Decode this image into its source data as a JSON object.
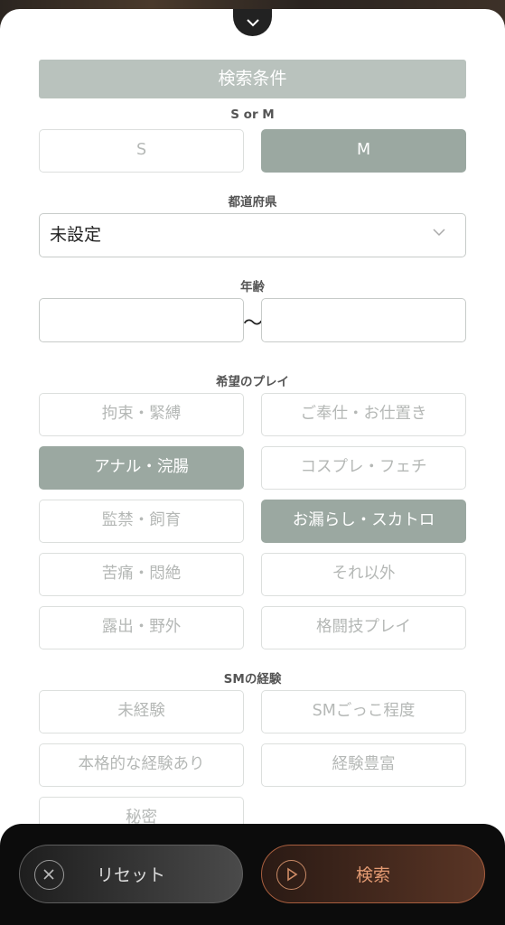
{
  "header": {
    "collapse_icon": "chevron-down-icon"
  },
  "title": "検索条件",
  "s_or_m": {
    "label": "S or M",
    "options": [
      {
        "label": "S",
        "selected": false
      },
      {
        "label": "M",
        "selected": true
      }
    ]
  },
  "prefecture": {
    "label": "都道府県",
    "value": "未設定"
  },
  "age": {
    "label": "年齢",
    "separator": "〜",
    "min": "",
    "max": ""
  },
  "play": {
    "label": "希望のプレイ",
    "options": [
      {
        "label": "拘束・緊縛",
        "selected": false
      },
      {
        "label": "ご奉仕・お仕置き",
        "selected": false
      },
      {
        "label": "アナル・浣腸",
        "selected": true
      },
      {
        "label": "コスプレ・フェチ",
        "selected": false
      },
      {
        "label": "監禁・飼育",
        "selected": false
      },
      {
        "label": "お漏らし・スカトロ",
        "selected": true
      },
      {
        "label": "苦痛・悶絶",
        "selected": false
      },
      {
        "label": "それ以外",
        "selected": false
      },
      {
        "label": "露出・野外",
        "selected": false
      },
      {
        "label": "格闘技プレイ",
        "selected": false
      }
    ]
  },
  "experience": {
    "label": "SMの経験",
    "options": [
      {
        "label": "未経験",
        "selected": false
      },
      {
        "label": "SMごっこ程度",
        "selected": false
      },
      {
        "label": "本格的な経験あり",
        "selected": false
      },
      {
        "label": "経験豊富",
        "selected": false
      },
      {
        "label": "秘密",
        "selected": false
      }
    ]
  },
  "footer": {
    "reset_label": "リセット",
    "search_label": "検索"
  },
  "colors": {
    "selected": "#9ba8a1",
    "title_bar": "#b9c2bd",
    "search_accent": "#e39a72"
  }
}
